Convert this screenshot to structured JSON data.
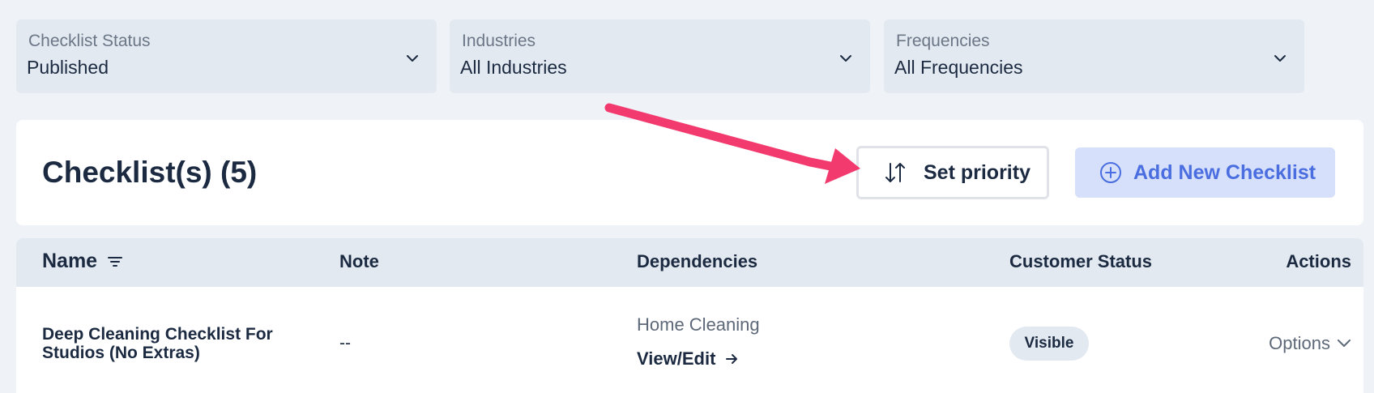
{
  "filters": [
    {
      "label": "Checklist Status",
      "value": "Published"
    },
    {
      "label": "Industries",
      "value": "All Industries"
    },
    {
      "label": "Frequencies",
      "value": "All Frequencies"
    }
  ],
  "header": {
    "title": "Checklist(s) (5)",
    "set_priority_label": "Set priority",
    "add_label": "Add New Checklist"
  },
  "table": {
    "columns": {
      "name": "Name",
      "note": "Note",
      "dependencies": "Dependencies",
      "customer_status": "Customer Status",
      "actions": "Actions"
    },
    "rows": [
      {
        "name": "Deep Cleaning Checklist For Studios (No Extras)",
        "note": "--",
        "dependency": "Home Cleaning",
        "dependency_link": "View/Edit",
        "status": "Visible",
        "actions": "Options"
      }
    ]
  },
  "colors": {
    "accent": "#4a6ee0",
    "accent_bg": "#d6e0fb",
    "annotation_arrow": "#f23a6e"
  },
  "icons": [
    "chevron-down-icon",
    "sort-arrows-icon",
    "plus-circle-icon",
    "filter-lines-icon",
    "arrow-right-icon"
  ]
}
